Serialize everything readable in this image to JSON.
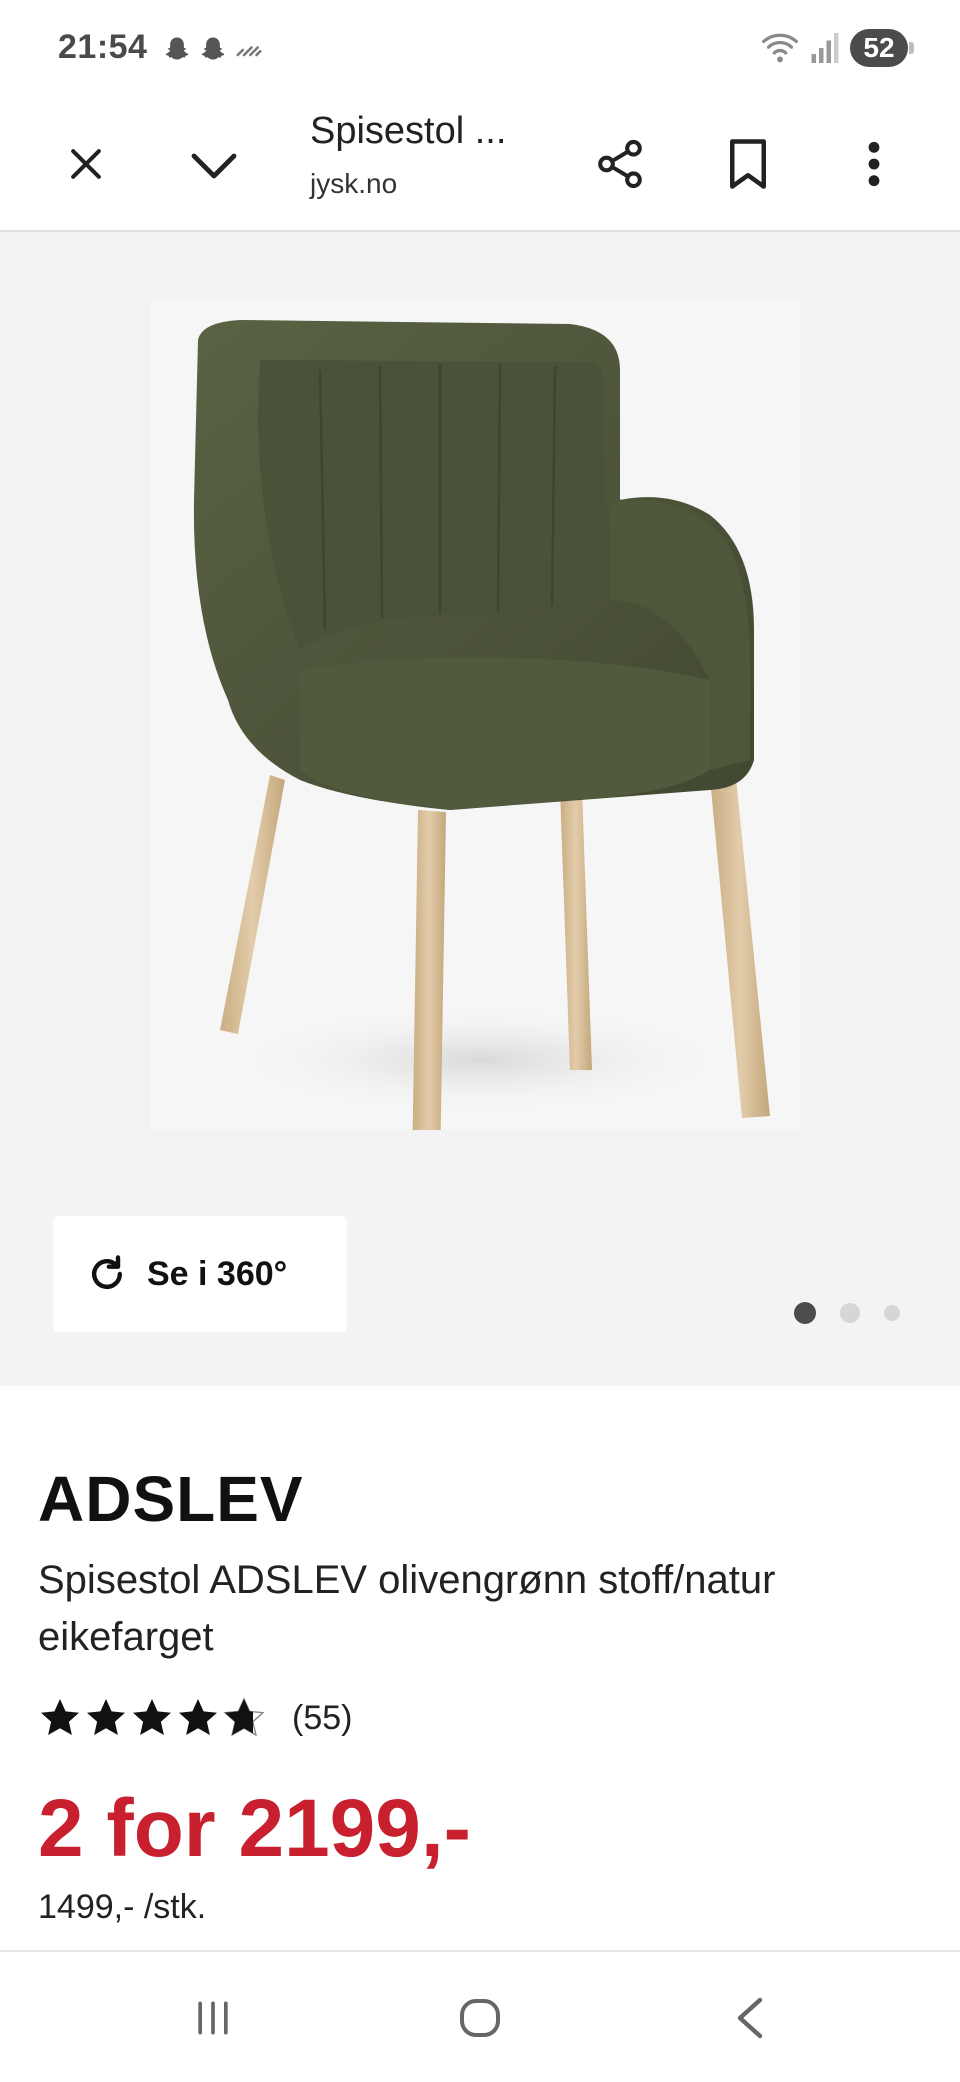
{
  "status_bar": {
    "time": "21:54",
    "battery": "52",
    "icons": [
      "snapchat-ghost-icon",
      "snapchat-ghost-icon",
      "missed-call-icon",
      "wifi-icon",
      "signal-icon"
    ]
  },
  "toolbar": {
    "title": "Spisestol ...",
    "domain": "jysk.no",
    "icons": [
      "close-icon",
      "chevron-down-icon",
      "share-icon",
      "bookmark-icon",
      "more-vert-icon"
    ]
  },
  "gallery": {
    "view360_label": "Se i 360°",
    "pages": 3,
    "active_page": 1
  },
  "product": {
    "title": "ADSLEV",
    "description": "Spisestol ADSLEV olivengrønn stoff/natur eikefarget",
    "rating": 4.6,
    "rating_max": 5,
    "review_count": "(55)",
    "price_main": "2 for 2199,-",
    "price_unit": "1499,- /stk."
  },
  "colors": {
    "price": "#c8202f",
    "chair_fabric": "#4d5438",
    "chair_wood": "#d8bf97"
  },
  "navbar": {
    "icons": [
      "recent-apps-icon",
      "home-icon",
      "back-icon"
    ]
  }
}
